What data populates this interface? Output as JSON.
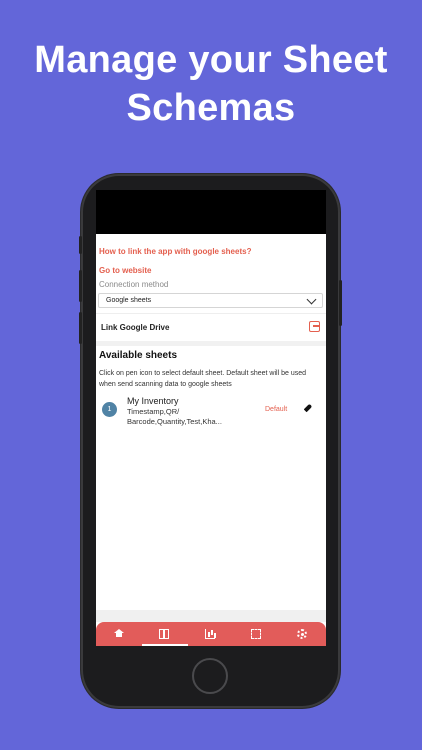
{
  "headline": {
    "line1": "Manage your Sheet",
    "line2": "Schemas"
  },
  "colors": {
    "background": "#6366d9",
    "accent": "#e4604f",
    "nav_bar": "#e25c5a",
    "item_badge": "#5083a5"
  },
  "screen": {
    "help_link": "How to link the app with google sheets?",
    "website_link": "Go to website",
    "connection_label": "Connection method",
    "connection_value": "Google sheets",
    "link_drive_label": "Link Google Drive",
    "available_title": "Available sheets",
    "available_desc": "Click on pen icon to select default sheet. Default sheet will be used when send scanning data to google sheets",
    "sheets": [
      {
        "index": "1",
        "name": "My Inventory",
        "columns": "Timestamp,QR/ Barcode,Quantity,Test,Kha...",
        "status": "Default",
        "icon": "pen-icon"
      }
    ]
  },
  "nav": {
    "items": [
      {
        "icon": "home-icon"
      },
      {
        "icon": "sheet-icon",
        "active": true
      },
      {
        "icon": "chart-icon"
      },
      {
        "icon": "qr-code-icon"
      },
      {
        "icon": "gear-icon"
      }
    ]
  }
}
